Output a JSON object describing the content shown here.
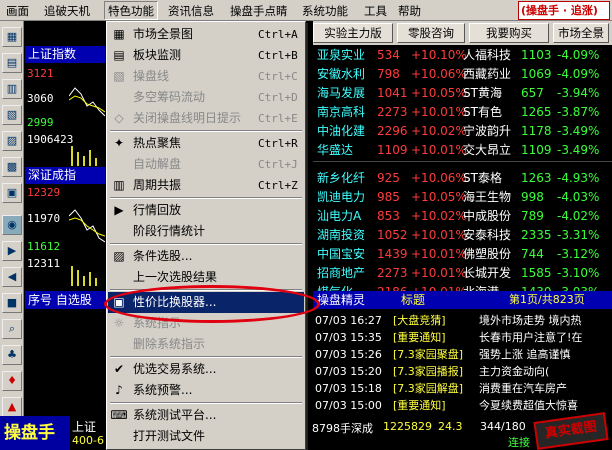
{
  "menubar": {
    "items": [
      "画面",
      "追破天机",
      "特色功能",
      "资讯信息",
      "操盘手点睛",
      "系统功能",
      "工具",
      "帮助"
    ],
    "logo": "(操盘手 · 追涨)"
  },
  "left_panel": {
    "title1": "上证指数",
    "v1a": "3121",
    "v1b": "3060",
    "v1c": "2999",
    "title2": "深证成指",
    "v2a": "12329",
    "v2b": "11970",
    "v2c": "11612",
    "v2d": "12311",
    "vol1": "1906423"
  },
  "toolbar": {
    "b1": "市场全景",
    "b2": "板块监测",
    "b3": "零股咨询",
    "b4": "我要购买",
    "b5": "实验主力版"
  },
  "menu": {
    "items": [
      {
        "icon": "▦",
        "label": "市场全景图",
        "shortcut": "Ctrl+A",
        "disabled": false
      },
      {
        "icon": "▤",
        "label": "板块监测",
        "shortcut": "Ctrl+B",
        "disabled": false
      },
      {
        "icon": "▧",
        "label": "操盘线",
        "shortcut": "Ctrl+C",
        "disabled": true
      },
      {
        "icon": "",
        "label": "多空筹码流动",
        "shortcut": "Ctrl+D",
        "disabled": true
      },
      {
        "icon": "◇",
        "label": "关闭操盘线明日提示",
        "shortcut": "Ctrl+E",
        "disabled": true
      },
      {
        "icon": "✦",
        "label": "热点聚焦",
        "shortcut": "Ctrl+R",
        "disabled": false
      },
      {
        "icon": "",
        "label": "自动解盘",
        "shortcut": "Ctrl+J",
        "disabled": true
      },
      {
        "icon": "▥",
        "label": "周期共振",
        "shortcut": "Ctrl+Z",
        "disabled": false
      },
      {
        "icon": "▶",
        "label": "行情回放",
        "shortcut": "",
        "disabled": false
      },
      {
        "icon": "",
        "label": "阶段行情统计",
        "shortcut": "",
        "disabled": false
      },
      {
        "icon": "▨",
        "label": "条件选股...",
        "shortcut": "",
        "disabled": false
      },
      {
        "icon": "",
        "label": "上一次选股结果",
        "shortcut": "",
        "disabled": false
      },
      {
        "icon": "▣",
        "label": "性价比换股器...",
        "shortcut": "",
        "disabled": false
      },
      {
        "icon": "☼",
        "label": "系统指示",
        "shortcut": "",
        "disabled": true
      },
      {
        "icon": "",
        "label": "删除系统指示",
        "shortcut": "",
        "disabled": true
      },
      {
        "icon": "✔",
        "label": "优选交易系统...",
        "shortcut": "",
        "disabled": false
      },
      {
        "icon": "♪",
        "label": "系统预警...",
        "shortcut": "",
        "disabled": false
      },
      {
        "icon": "⌨",
        "label": "系统测试平台...",
        "shortcut": "",
        "disabled": false
      },
      {
        "icon": "",
        "label": "打开测试文件",
        "shortcut": "",
        "disabled": false
      }
    ]
  },
  "rank": {
    "rows1": [
      {
        "name": "亚泉实业",
        "p": "534",
        "c": "+10.10%",
        "name2": "人福科技",
        "p2": "1103",
        "c2": "-4.09%"
      },
      {
        "name": "安徽水利",
        "p": "798",
        "c": "+10.06%",
        "name2": "西藏药业",
        "p2": "1069",
        "c2": "-4.09%"
      },
      {
        "name": "海马发展",
        "p": "1041",
        "c": "+10.05%",
        "name2": "ST黄海",
        "p2": "657",
        "c2": "-3.94%"
      },
      {
        "name": "南京高科",
        "p": "2273",
        "c": "+10.01%",
        "name2": "ST有色",
        "p2": "1265",
        "c2": "-3.87%"
      },
      {
        "name": "中油化建",
        "p": "2296",
        "c": "+10.02%",
        "name2": "宁波韵升",
        "p2": "1178",
        "c2": "-3.49%"
      },
      {
        "name": "华盛达",
        "p": "1109",
        "c": "+10.01%",
        "name2": "交大昂立",
        "p2": "1109",
        "c2": "-3.49%"
      }
    ],
    "rows2": [
      {
        "name": "新乡化纤",
        "p": "925",
        "c": "+10.06%",
        "name2": "ST泰格",
        "p2": "1263",
        "c2": "-4.93%"
      },
      {
        "name": "凯迪电力",
        "p": "985",
        "c": "+10.05%",
        "name2": "海王生物",
        "p2": "998",
        "c2": "-4.03%"
      },
      {
        "name": "汕电力A",
        "p": "853",
        "c": "+10.02%",
        "name2": "中成股份",
        "p2": "789",
        "c2": "-4.02%"
      },
      {
        "name": "湖南投资",
        "p": "1052",
        "c": "+10.01%",
        "name2": "安泰科技",
        "p2": "2335",
        "c2": "-3.31%"
      },
      {
        "name": "中国宝安",
        "p": "1439",
        "c": "+10.01%",
        "name2": "佛塑股份",
        "p2": "744",
        "c2": "-3.12%"
      },
      {
        "name": "招商地产",
        "p": "2273",
        "c": "+10.01%",
        "name2": "长城开发",
        "p2": "1585",
        "c2": "-3.10%"
      },
      {
        "name": "煤气化",
        "p": "2186",
        "c": "+10.01%",
        "name2": "北海港",
        "p2": "1430",
        "c2": "-3.03%"
      }
    ]
  },
  "selbar": {
    "label": "序号 自选股"
  },
  "sprite": {
    "title": "操盘精灵",
    "col": "标题",
    "page": "第1页/共823页"
  },
  "news": [
    {
      "t": "07/03 16:27",
      "tag": "[大盘竞猜]",
      "txt": "境外市场走势 境内热"
    },
    {
      "t": "07/03 15:35",
      "tag": "[重要通知]",
      "txt": "长春市用户注意了!在"
    },
    {
      "t": "07/03 15:26",
      "tag": "[7.3家园聚盘]",
      "txt": "强势上涨 追高谨慎"
    },
    {
      "t": "07/03 15:20",
      "tag": "[7.3家园播报]",
      "txt": "主力资金动向("
    },
    {
      "t": "07/03 15:18",
      "tag": "[7.3家园解盘]",
      "txt": "消费重在汽车房产"
    },
    {
      "t": "07/03 15:00",
      "tag": "[重要通知]",
      "txt": "今夏续费超值大惊喜"
    }
  ],
  "bottom": {
    "brand": "操盘手",
    "tag": "上证",
    "num": "400-6",
    "sz": "8798手深成",
    "v1": "1225829",
    "v2": "24.3",
    "v3": "344/180",
    "conn": "连接",
    "stamp": "真实截图"
  }
}
